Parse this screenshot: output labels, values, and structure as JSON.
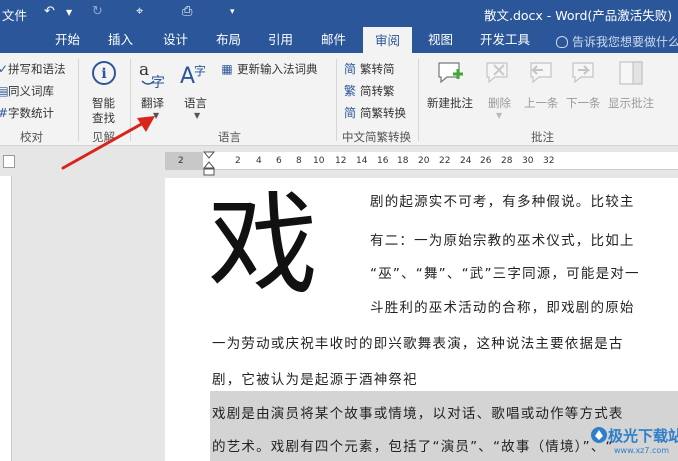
{
  "titlebar": {
    "file_menu": "文件",
    "title": "散文.docx - Word(产品激活失败)"
  },
  "tabs": [
    "开始",
    "插入",
    "设计",
    "布局",
    "引用",
    "邮件",
    "审阅",
    "视图",
    "开发工具"
  ],
  "active_tab": "审阅",
  "tell_me": "告诉我您想要做什么",
  "ribbon": {
    "proofing": {
      "items": [
        "拼写和语法",
        "同义词库",
        "字数统计"
      ],
      "label": "校对"
    },
    "insights": {
      "smart_lookup": "智能\n查找",
      "smart_lookup_line1": "智能",
      "smart_lookup_line2": "查找",
      "label": "见解"
    },
    "language": {
      "translate": "翻译",
      "language": "语言",
      "update_ime": "更新输入法词典",
      "label": "语言"
    },
    "chinese_conversion": {
      "items": [
        "繁转简",
        "简转繁",
        "简繁转换"
      ],
      "label": "中文简繁转换"
    },
    "comments": {
      "new": "新建批注",
      "delete": "删除",
      "previous": "上一条",
      "next": "下一条",
      "show": "显示批注",
      "label": "批注"
    }
  },
  "ruler_ticks": [
    "2",
    "2",
    "4",
    "6",
    "8",
    "10",
    "12",
    "14",
    "16",
    "18",
    "20",
    "22",
    "24",
    "26",
    "28",
    "30",
    "32"
  ],
  "document": {
    "drop_cap": "戏",
    "lines": [
      "剧的起源实不可考，有多种假说。比较主",
      "有二：一为原始宗教的巫术仪式，比如上",
      "“巫”、“舞”、“武”三字同源，可能是对一",
      "斗胜利的巫术活动的合称，即戏剧的原始",
      "一为劳动或庆祝丰收时的即兴歌舞表演，这种说法主要依据是古",
      "剧，它被认为是起源于酒神祭祀",
      "戏剧是由演员将某个故事或情境，以对话、歌唱或动作等方式表",
      "的艺术。戏剧有四个元素，包括了“演员”、“故事（情境）”、“"
    ]
  },
  "watermark": {
    "title": "极光下载站",
    "url": "www.xz7.com"
  },
  "colors": {
    "word_blue": "#2b579a",
    "ribbon_bg": "#f3f3f3",
    "arrow_red": "#d9241b"
  }
}
